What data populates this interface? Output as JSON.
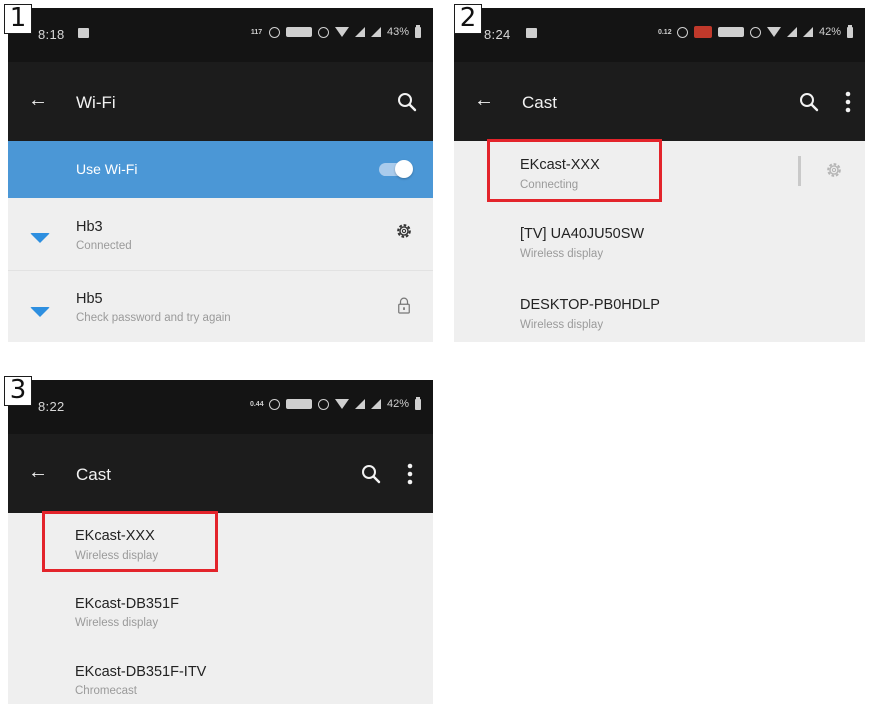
{
  "panel1": {
    "step": "1",
    "status": {
      "time": "8:18",
      "data_speed": "117",
      "battery": "43%"
    },
    "toolbar": {
      "title": "Wi-Fi"
    },
    "use_wifi": {
      "label": "Use Wi-Fi",
      "enabled": true
    },
    "networks": [
      {
        "name": "Hb3",
        "status": "Connected",
        "action_icon": "gear-icon"
      },
      {
        "name": "Hb5",
        "status": "Check password and try again",
        "action_icon": "lock-icon"
      }
    ]
  },
  "panel2": {
    "step": "2",
    "status": {
      "time": "8:24",
      "data_speed": "0.12",
      "battery": "42%"
    },
    "toolbar": {
      "title": "Cast"
    },
    "devices": [
      {
        "name": "EKcast-XXX",
        "status": "Connecting",
        "highlighted": true
      },
      {
        "name": "[TV] UA40JU50SW",
        "status": "Wireless display"
      },
      {
        "name": "DESKTOP-PB0HDLP",
        "status": "Wireless display"
      }
    ]
  },
  "panel3": {
    "step": "3",
    "status": {
      "time": "8:22",
      "data_speed": "0.44",
      "battery": "42%"
    },
    "toolbar": {
      "title": "Cast"
    },
    "devices": [
      {
        "name": "EKcast-XXX",
        "status": "Wireless display",
        "highlighted": true
      },
      {
        "name": "EKcast-DB351F",
        "status": "Wireless display"
      },
      {
        "name": "EKcast-DB351F-ITV",
        "status": "Chromecast"
      }
    ]
  },
  "colors": {
    "highlight": "#e3242b",
    "accent": "#4b97d6",
    "wifi_icon": "#2d8fe0"
  }
}
